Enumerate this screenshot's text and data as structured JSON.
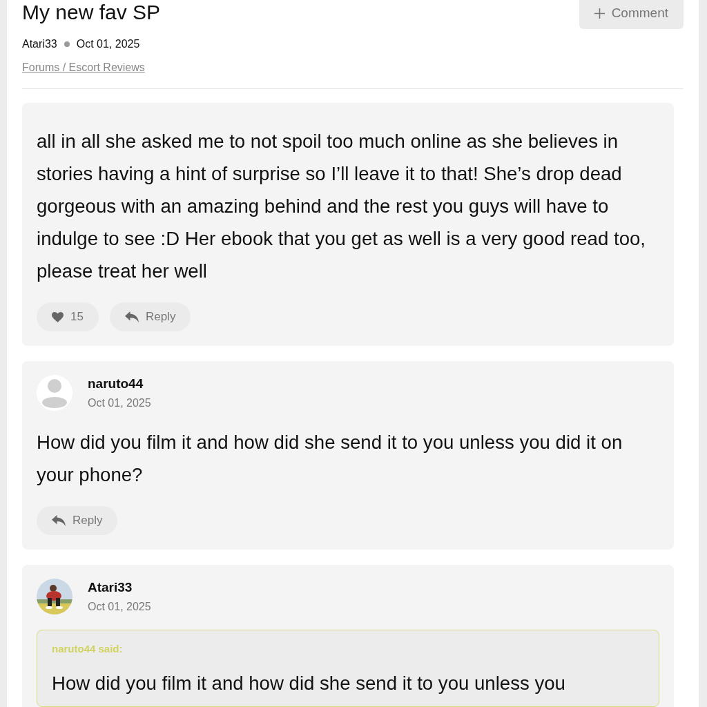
{
  "post": {
    "title": "My new fav SP",
    "author": "Atari33",
    "date": "Oct 01, 2025",
    "breadcrumb": "Forums / Escort Reviews",
    "comment_button": "Comment"
  },
  "entries": [
    {
      "kind": "body",
      "text": "all in all she asked me to not spoil too much online as she believes in stories having a hint of surprise so I’ll leave it to that! She’s drop dead gorgeous with an amazing behind and the rest you guys will have to indulge to see :D Her ebook that you get as well is a very good read too, please treat her well",
      "likes": "15",
      "reply": "Reply"
    },
    {
      "kind": "comment",
      "photo": false,
      "author": "naruto44",
      "date": "Oct 01, 2025",
      "text": "How did you film it and how did she send it to you unless you did it on your phone?",
      "reply": "Reply"
    },
    {
      "kind": "comment",
      "photo": true,
      "author": "Atari33",
      "date": "Oct 01, 2025",
      "quote": {
        "author": "naruto44 said:",
        "text": "How did you film it and how did she send it to you unless you"
      }
    }
  ]
}
